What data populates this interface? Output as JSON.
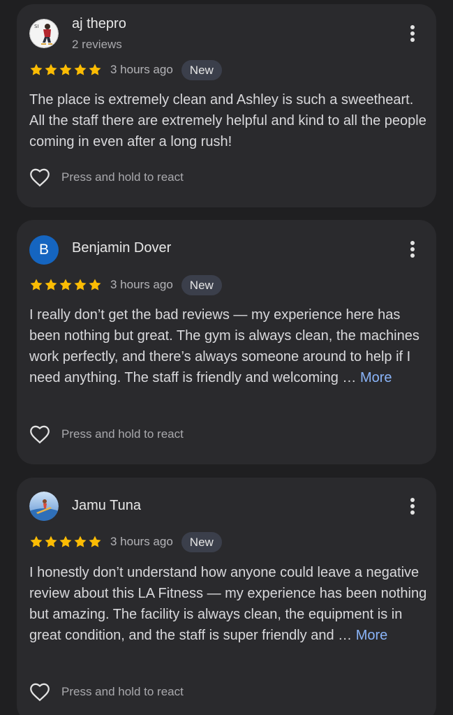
{
  "reviews": [
    {
      "name": "aj thepro",
      "meta": "2 reviews",
      "avatar_type": "photo",
      "stars": 5,
      "time": "3 hours ago",
      "badge": "New",
      "text": "The place is extremely clean and Ashley is such a sweetheart. All the staff there are extremely helpful and kind to all the people coming in even after a long rush!",
      "more": "",
      "react_label": "Press and hold to react"
    },
    {
      "name": "Benjamin Dover",
      "meta": "",
      "avatar_type": "letter",
      "avatar_letter": "B",
      "stars": 5,
      "time": "3 hours ago",
      "badge": "New",
      "text": "I really don’t get the bad reviews — my experience here has been nothing but great. The gym is always clean, the machines work perfectly, and there’s always someone around to help if I need anything. The staff is friendly and welcoming … ",
      "more": "More",
      "react_label": "Press and hold to react"
    },
    {
      "name": "Jamu Tuna",
      "meta": "",
      "avatar_type": "photo",
      "stars": 5,
      "time": "3 hours ago",
      "badge": "New",
      "text": "I honestly don’t understand how anyone could leave a negative review about this LA Fitness — my experience has been nothing but amazing. The facility is always clean, the equipment is in great condition, and the staff is super friendly and … ",
      "more": "More",
      "react_label": "Press and hold to react"
    }
  ],
  "icons": {
    "star": "star-icon",
    "menu": "more-vert-icon",
    "heart": "heart-outline-icon"
  },
  "colors": {
    "background": "#1f1f21",
    "card": "#2a2a2d",
    "star": "#fbbc04",
    "link": "#8ab4f8",
    "badge": "#3b3f4b",
    "avatar_letter_bg": "#1565c0"
  }
}
